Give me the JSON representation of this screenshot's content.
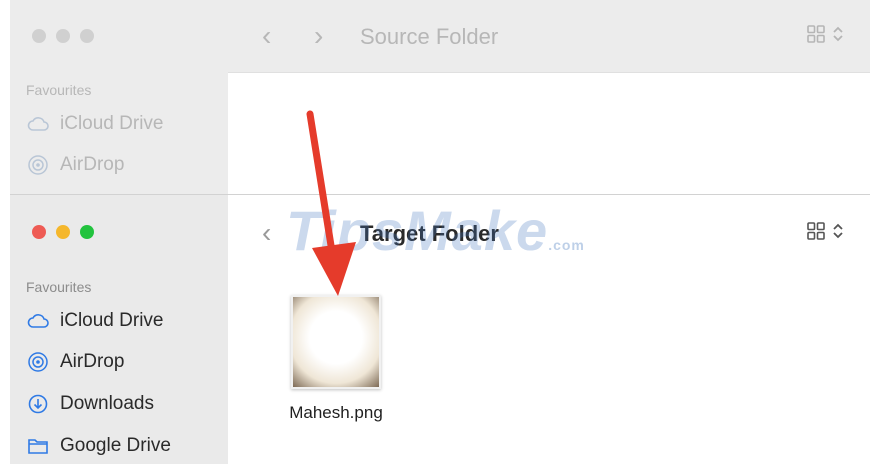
{
  "source_window": {
    "title": "Source Folder",
    "sidebar_section": "Favourites",
    "items": [
      {
        "label": "iCloud Drive",
        "icon": "cloud-icon"
      },
      {
        "label": "AirDrop",
        "icon": "airdrop-icon"
      }
    ]
  },
  "target_window": {
    "title": "Target Folder",
    "sidebar_section": "Favourites",
    "items": [
      {
        "label": "iCloud Drive",
        "icon": "cloud-icon"
      },
      {
        "label": "AirDrop",
        "icon": "airdrop-icon"
      },
      {
        "label": "Downloads",
        "icon": "download-icon"
      },
      {
        "label": "Google Drive",
        "icon": "folder-icon"
      }
    ],
    "file": {
      "name": "Mahesh.png"
    }
  },
  "watermark": {
    "text": "TipsMake",
    "suffix": ".com"
  },
  "colors": {
    "close": "#ee5b54",
    "minimize": "#f5b72c",
    "zoom": "#22c33e",
    "arrow": "#e53b2b",
    "icon_blue": "#2f7ae5"
  }
}
